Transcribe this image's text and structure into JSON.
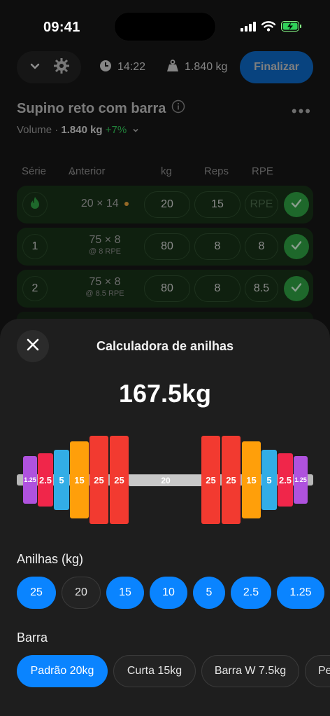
{
  "status_bar": {
    "time": "09:41"
  },
  "workout_header": {
    "elapsed": "14:22",
    "volume_total": "1.840 kg",
    "finish_label": "Finalizar"
  },
  "exercise": {
    "title": "Supino reto com barra",
    "volume_label": "Volume ·",
    "volume_value": "1.840 kg",
    "volume_change": "+7%",
    "columns": {
      "set": "Série",
      "previous": "Anterior",
      "kg": "kg",
      "reps": "Reps",
      "rpe": "RPE"
    },
    "sets": [
      {
        "num": "",
        "type": "warmup",
        "previous": "20 × 14",
        "previous_note": "",
        "kg": "20",
        "reps": "15",
        "rpe": "RPE"
      },
      {
        "num": "1",
        "type": "normal",
        "previous": "75 × 8",
        "previous_note": "@ 8 RPE",
        "kg": "80",
        "reps": "8",
        "rpe": "8"
      },
      {
        "num": "2",
        "type": "normal",
        "previous": "75 × 8",
        "previous_note": "@ 8.5 RPE",
        "kg": "80",
        "reps": "8",
        "rpe": "8.5"
      }
    ]
  },
  "calculator": {
    "title": "Calculadora de anilhas",
    "total": "167.5kg",
    "bar_label": "20",
    "left_plates": [
      "1.25",
      "2.5",
      "5",
      "15",
      "25",
      "25"
    ],
    "right_plates": [
      "25",
      "25",
      "15",
      "5",
      "2.5",
      "1.25"
    ],
    "plates_label": "Anilhas (kg)",
    "plates": [
      {
        "label": "25",
        "on": true
      },
      {
        "label": "20",
        "on": false
      },
      {
        "label": "15",
        "on": true
      },
      {
        "label": "10",
        "on": true
      },
      {
        "label": "5",
        "on": true
      },
      {
        "label": "2.5",
        "on": true
      },
      {
        "label": "1.25",
        "on": true
      }
    ],
    "bar_section_label": "Barra",
    "bars": [
      {
        "label": "Padrão 20kg",
        "on": true
      },
      {
        "label": "Curta 15kg",
        "on": false
      },
      {
        "label": "Barra W 7.5kg",
        "on": false
      },
      {
        "label": "Per",
        "on": false
      }
    ]
  },
  "colors": {
    "accent": "#0a84ff",
    "success": "#34c759",
    "plate_25": "#f23a30",
    "plate_15": "#ff9f0a",
    "plate_5": "#32ade6",
    "plate_2_5": "#f0264a",
    "plate_1_25": "#af52de"
  }
}
